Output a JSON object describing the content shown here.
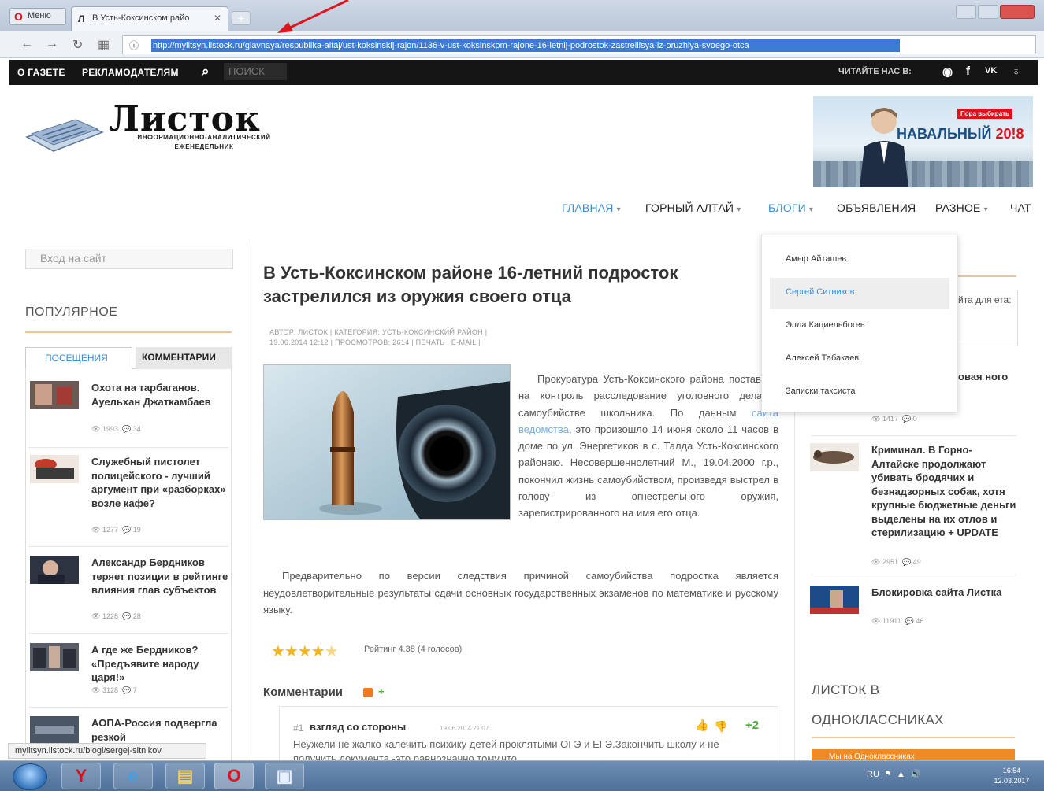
{
  "browser": {
    "menu_label": "Меню",
    "tab_title": "В Усть-Коксинском райо",
    "url": "http://mylitsyn.listock.ru/glavnaya/respublika-altaj/ust-koksinskij-rajon/1136-v-ust-koksinskom-rajone-16-letnij-podrostok-zastrelilsya-iz-oruzhiya-svoego-otca",
    "status_url": "mylitsyn.listock.ru/blogi/sergej-sitnikov"
  },
  "topbar": {
    "about": "О ГАЗЕТЕ",
    "advertisers": "РЕКЛАМОДАТЕЛЯМ",
    "search_placeholder": "ПОИСК",
    "read_us": "ЧИТАЙТЕ НАС В:"
  },
  "header": {
    "logo_title": "Листок",
    "logo_sub1": "ИНФОРМАЦИОННО-АНАЛИТИЧЕСКИЙ",
    "logo_sub2": "ЕЖЕНЕДЕЛЬНИК",
    "banner_tag": "Пора выбирать",
    "banner_name": "НАВАЛЬНЫЙ",
    "banner_year": "20!8"
  },
  "nav": {
    "items": [
      "ГЛАВНАЯ",
      "ГОРНЫЙ АЛТАЙ",
      "БЛОГИ",
      "ОБЪЯВЛЕНИЯ",
      "РАЗНОЕ",
      "ЧАТ"
    ]
  },
  "dropdown": {
    "items": [
      "Амыр Айташев",
      "Сергей Ситников",
      "Элла Кациельбоген",
      "Алексей Табакаев",
      "Записки таксиста"
    ]
  },
  "sidebar": {
    "login": "Вход на сайт",
    "popular": "ПОПУЛЯРНОЕ",
    "tab_views": "ПОСЕЩЕНИЯ",
    "tab_comments": "КОММЕНТАРИИ",
    "items": [
      {
        "title": "Охота на тарбаганов. Ауельхан Джаткамбаев",
        "views": "1993",
        "comments": "34"
      },
      {
        "title": "Служебный пистолет полицейского - лучший аргумент при «разборках» возле кафе?",
        "views": "1277",
        "comments": "19"
      },
      {
        "title": "Александр Бердников теряет позиции в рейтинге влияния глав субъектов",
        "views": "1228",
        "comments": "28"
      },
      {
        "title": "А где же Бердников? «Предъявите народу царя!»",
        "views": "3128",
        "comments": "7"
      },
      {
        "title": "АОПА-Россия подвергла резкой",
        "views": "",
        "comments": ""
      }
    ]
  },
  "article": {
    "title": "В Усть-Коксинском районе 16-летний подросток застрелился из оружия своего отца",
    "meta_line1": "АВТОР: ЛИСТОК | КАТЕГОРИЯ: УСТЬ-КОКСИНСКИЙ РАЙОН |",
    "meta_line2": "19.06.2014 12:12 | ПРОСМОТРОВ: 2614 | ПЕЧАТЬ | E-MAIL |",
    "p1_a": "Прокуратура Усть-Коксинского района поставила на контроль расследование уголовного дела о самоубийстве школьника. По данным ",
    "p1_link": "сайта ведомства",
    "p1_b": ", это произошло 14 июня около 11 часов в доме по ул. Энергетиков в с. Талда Усть-Коксинского районаю. Несовершеннолетний М., 19.04.2000 г.р., покончил жизнь самоубийством, произведя выстрел в голову из огнестрельного оружия, зарегистрированного на имя его отца.",
    "p2": "Предварительно по версии следствия причиной самоубийства подростка является неудовлетворительные результаты сдачи основных государственных экзаменов по математике и русскому языку.",
    "rating": "Рейтинг 4.38 (4 голосов)",
    "rating_value": 4.38,
    "comments_heading": "Комментарии",
    "comment": {
      "num": "#1",
      "title": "взгляд со стороны",
      "date": "19.06.2014 21:07",
      "score": "+2",
      "text": "Неужели не жалко калечить психику детей проклятыми ОГЭ и ЕГЭ.Закончить школу и не получить документа -это равнозначно тому,что"
    }
  },
  "right": {
    "box_text": "йта для ета:",
    "frag": "овая ного",
    "frag_meta_views": "1417",
    "frag_meta_comments": "0",
    "items": [
      {
        "title": "Криминал. В Горно-Алтайске продолжают убивать бродячих и безнадзорных собак, хотя крупные бюджетные деньги выделены на их отлов и стерилизацию + UPDATE",
        "views": "2951",
        "comments": "49"
      },
      {
        "title": "Блокировка сайта Листка",
        "views": "11911",
        "comments": "46"
      }
    ],
    "ok_heading1": "ЛИСТОК В",
    "ok_heading2": "ОДНОКЛАССНИКАХ",
    "ok_button": "Мы на Одноклассниках"
  },
  "taskbar": {
    "lang": "RU",
    "time": "16:54",
    "date": "12.03.2017"
  }
}
